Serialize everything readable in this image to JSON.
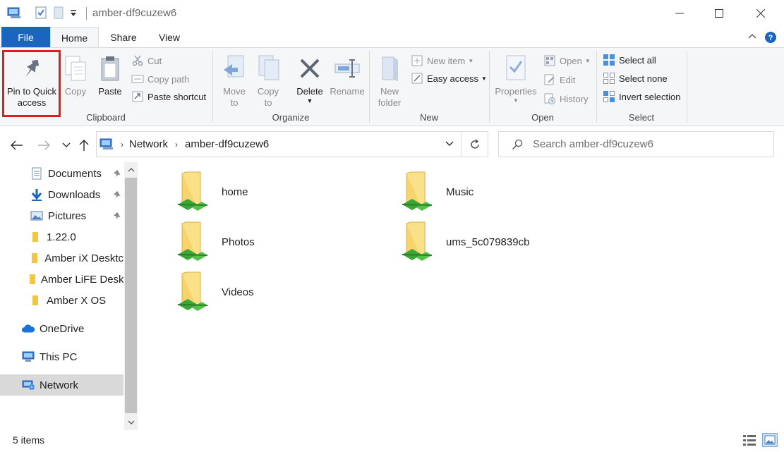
{
  "window": {
    "title": "amber-df9cuzew6",
    "minimize_icon": "minimize-icon",
    "maximize_icon": "maximize-icon",
    "close_icon": "close-icon"
  },
  "tabs": {
    "file": "File",
    "home": "Home",
    "share": "Share",
    "view": "View"
  },
  "ribbon": {
    "clipboard": {
      "label": "Clipboard",
      "pin_line1": "Pin to Quick",
      "pin_line2": "access",
      "copy": "Copy",
      "paste": "Paste",
      "cut": "Cut",
      "copy_path": "Copy path",
      "paste_shortcut": "Paste shortcut"
    },
    "organize": {
      "label": "Organize",
      "move_to_1": "Move",
      "move_to_2": "to",
      "copy_to_1": "Copy",
      "copy_to_2": "to",
      "delete": "Delete",
      "rename": "Rename"
    },
    "new": {
      "label": "New",
      "new_folder_1": "New",
      "new_folder_2": "folder",
      "new_item": "New item",
      "easy_access": "Easy access"
    },
    "open": {
      "label": "Open",
      "properties": "Properties",
      "open": "Open",
      "edit": "Edit",
      "history": "History"
    },
    "select": {
      "label": "Select",
      "select_all": "Select all",
      "select_none": "Select none",
      "invert_selection": "Invert selection"
    }
  },
  "address": {
    "crumbs": [
      "Network",
      "amber-df9cuzew6"
    ],
    "search_placeholder": "Search amber-df9cuzew6"
  },
  "sidebar": {
    "items": [
      {
        "label": "Documents",
        "icon": "documents-icon",
        "pinned": true
      },
      {
        "label": "Downloads",
        "icon": "downloads-icon",
        "pinned": true
      },
      {
        "label": "Pictures",
        "icon": "pictures-icon",
        "pinned": true
      },
      {
        "label": "1.22.0",
        "icon": "folder-icon",
        "pinned": false
      },
      {
        "label": "Amber iX Desktc",
        "icon": "folder-icon",
        "pinned": false
      },
      {
        "label": "Amber LiFE Desk",
        "icon": "folder-icon",
        "pinned": false
      },
      {
        "label": "Amber X OS",
        "icon": "folder-icon",
        "pinned": false
      },
      {
        "label": "OneDrive",
        "icon": "onedrive-icon",
        "pinned": false
      },
      {
        "label": "This PC",
        "icon": "this-pc-icon",
        "pinned": false
      },
      {
        "label": "Network",
        "icon": "network-icon",
        "pinned": false,
        "selected": true
      }
    ]
  },
  "content": {
    "items": [
      {
        "name": "home",
        "icon": "shared-folder-icon"
      },
      {
        "name": "Music",
        "icon": "shared-folder-icon"
      },
      {
        "name": "Photos",
        "icon": "shared-folder-icon"
      },
      {
        "name": "ums_5c079839cb",
        "icon": "shared-folder-icon"
      },
      {
        "name": "Videos",
        "icon": "shared-folder-icon"
      }
    ]
  },
  "status": {
    "count": "5 items"
  },
  "colors": {
    "accent": "#1a65c0",
    "highlight": "#e01c1c",
    "folder": "#f7d46b"
  }
}
